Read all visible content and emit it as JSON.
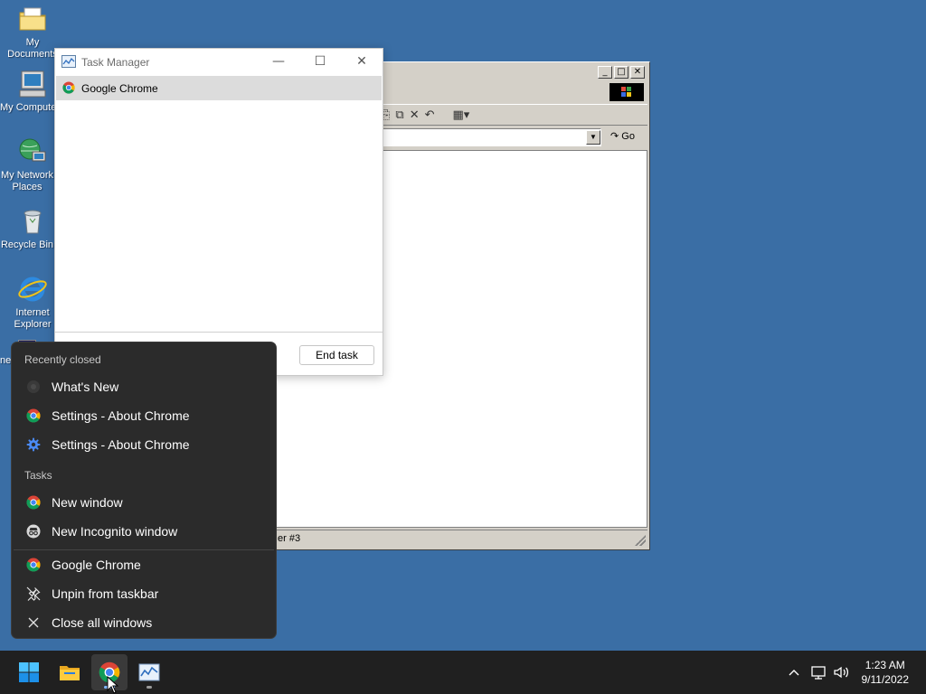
{
  "desktop": {
    "icons": [
      {
        "label": "My Documents"
      },
      {
        "label": "My Computer"
      },
      {
        "label": "My Network Places"
      },
      {
        "label": "Recycle Bin"
      },
      {
        "label": "Internet Explorer"
      },
      {
        "label": "ne"
      }
    ]
  },
  "classic_window": {
    "go_label": "Go",
    "status_text": "er #3"
  },
  "task_manager": {
    "title": "Task Manager",
    "process_row": "Google Chrome",
    "end_task_label": "End task"
  },
  "jumplist": {
    "recently_closed_header": "Recently closed",
    "recent_items": [
      {
        "label": "What's New"
      },
      {
        "label": "Settings - About Chrome"
      },
      {
        "label": "Settings - About Chrome"
      }
    ],
    "tasks_header": "Tasks",
    "task_items": [
      {
        "label": "New window"
      },
      {
        "label": "New Incognito window"
      }
    ],
    "app_items": [
      {
        "label": "Google Chrome"
      },
      {
        "label": "Unpin from taskbar"
      },
      {
        "label": "Close all windows"
      }
    ]
  },
  "taskbar": {
    "time": "1:23 AM",
    "date": "9/11/2022"
  },
  "colors": {
    "desktop": "#3a6ea5",
    "jumplist_bg": "#2b2b2b",
    "taskbar_bg": "#202020",
    "accent": "#7fb6ff"
  }
}
